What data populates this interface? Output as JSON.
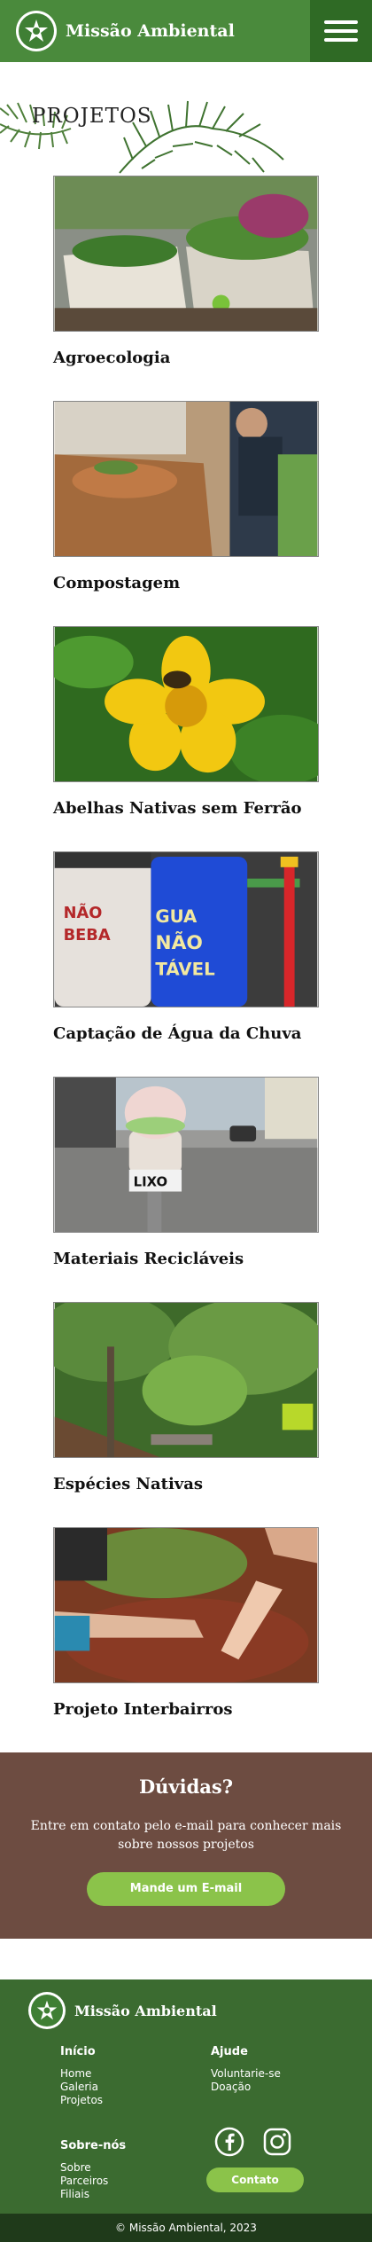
{
  "header": {
    "brand": "Missão Ambiental",
    "logo_icon": "star-leaf-logo-icon",
    "menu_icon": "hamburger-menu-icon",
    "color": "#4a8a3c"
  },
  "page": {
    "title": "PROJETOS"
  },
  "projects": [
    {
      "title": "Agroecologia",
      "photo": "garden-beds-photo"
    },
    {
      "title": "Compostagem",
      "photo": "compost-photo"
    },
    {
      "title": "Abelhas Nativas sem Ferrão",
      "photo": "bee-on-yellow-flower-photo"
    },
    {
      "title": "Captação de Água da Chuva",
      "photo": "rain-barrels-photo"
    },
    {
      "title": "Materiais Recicláveis",
      "photo": "recycling-bin-street-photo"
    },
    {
      "title": "Espécies Nativas",
      "photo": "native-forest-trail-photo"
    },
    {
      "title": "Projeto Interbairros",
      "photo": "hands-planting-photo"
    }
  ],
  "contact": {
    "title": "Dúvidas?",
    "text": "Entre em contato pelo e-mail para conhecer mais sobre nossos projetos",
    "button": "Mande um E-mail",
    "color": "#6d4c41"
  },
  "footer": {
    "brand": "Missão Ambiental",
    "col1": {
      "heading": "Início",
      "links": [
        "Home",
        "Galeria",
        "Projetos"
      ]
    },
    "col2": {
      "heading": "Ajude",
      "links": [
        "Voluntarie-se",
        "Doação"
      ]
    },
    "col3": {
      "heading": "Sobre-nós",
      "links": [
        "Sobre",
        "Parceiros",
        "Filiais"
      ]
    },
    "social": [
      "facebook-icon",
      "instagram-icon"
    ],
    "contact_button": "Contato",
    "copyright": "© Missão Ambiental, 2023",
    "color": "#3b6b30"
  }
}
